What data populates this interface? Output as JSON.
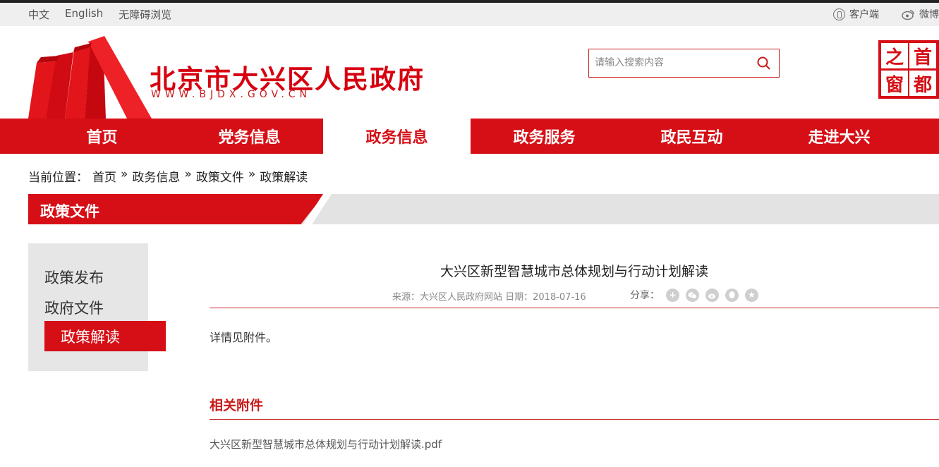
{
  "topbar": {
    "lang_zh": "中文",
    "lang_en": "English",
    "accessibility": "无障碍浏览",
    "client_label": "客户端",
    "weibo_label": "微博"
  },
  "header": {
    "site_title": "北京市大兴区人民政府",
    "site_url": "WWW.BJDX.GOV.CN",
    "search_placeholder": "请输入搜索内容",
    "seal": [
      "首",
      "都",
      "之",
      "窗"
    ]
  },
  "nav": {
    "items": [
      "首页",
      "党务信息",
      "政务信息",
      "政务服务",
      "政民互动",
      "走进大兴"
    ],
    "active_index": 2
  },
  "breadcrumb": {
    "label": "当前位置：",
    "items": [
      "首页",
      "政务信息",
      "政策文件",
      "政策解读"
    ],
    "separator": "»"
  },
  "section": {
    "title": "政策文件"
  },
  "sidebar": {
    "items": [
      "政策发布",
      "政府文件",
      "政策解读"
    ],
    "active_index": 2
  },
  "article": {
    "title": "大兴区新型智慧城市总体规划与行动计划解读",
    "meta": "来源：大兴区人民政府网站 日期：2018-07-16",
    "share_label": "分享：",
    "share_icons": [
      "plus-icon",
      "wechat-icon",
      "weibo-icon",
      "qq-icon",
      "qzone-icon"
    ],
    "body": "详情见附件。",
    "attachments_title": "相关附件",
    "attachment_link": "大兴区新型智慧城市总体规划与行动计划解读.pdf"
  },
  "colors": {
    "brand_red": "#d60f16",
    "banner_gray": "#e3e3e3",
    "sidebar_gray": "#e6e6e6"
  }
}
